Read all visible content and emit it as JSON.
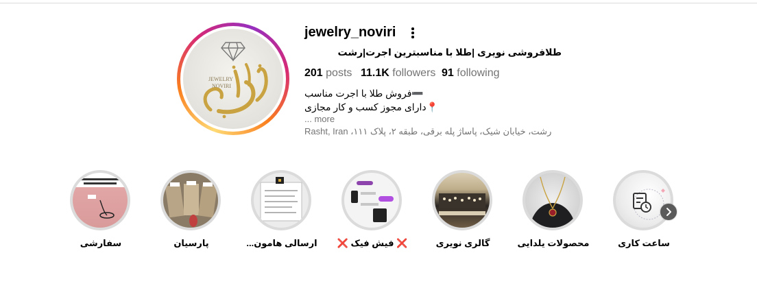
{
  "profile": {
    "username": "jewelry_noviri",
    "full_name": "طلافروشی نویری |طلا با مناسبترین اجرت|رشت",
    "stats": {
      "posts_count": "201",
      "posts_label": "posts",
      "followers_count": "11.1K",
      "followers_label": "followers",
      "following_count": "91",
      "following_label": "following"
    },
    "bio_line1": "➖فروش طلا با اجرت مناسب",
    "bio_line2": "📍دارای مجوز کسب و کار مجازی",
    "more_label": "... more",
    "address": "رشت، خیابان شیک، پاساژ پله برقی، طبقه ۲، پلاک ۱۱۱، Rasht, Iran",
    "logo_text_line1": "JEWELRY",
    "logo_text_line2": "NOVIRI",
    "logo_calligraphy": "نویری"
  },
  "highlights": [
    {
      "label": "ساعت کاری"
    },
    {
      "label": "محصولات یلدایی"
    },
    {
      "label": "گالری نویری"
    },
    {
      "label": "فیش فیک",
      "mark": "❌"
    },
    {
      "label": "ارسالی هامون..."
    },
    {
      "label": "پارسیان"
    },
    {
      "label": "سفارشی"
    }
  ],
  "colors": {
    "text_secondary": "#737373",
    "highlight_ring": "#dbdbdb",
    "gold": "#c9a241",
    "accent_red": "#d7263d"
  },
  "icons": {
    "more": "more-options-icon",
    "next": "chevron-right-icon"
  }
}
